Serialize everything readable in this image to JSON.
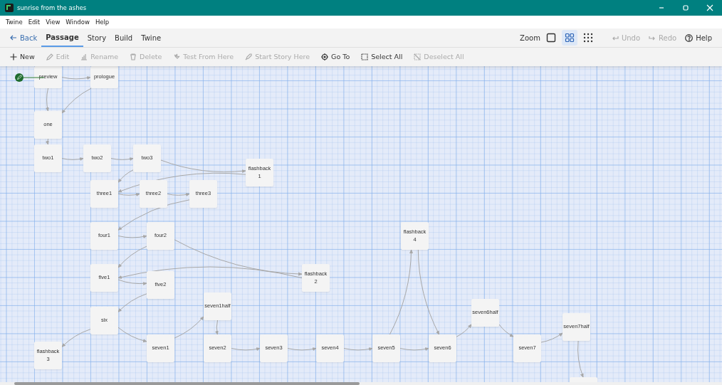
{
  "window": {
    "title": "sunrise from the ashes"
  },
  "menu": [
    "Twine",
    "Edit",
    "View",
    "Window",
    "Help"
  ],
  "back": {
    "label": "Back"
  },
  "tabs": [
    {
      "label": "Passage",
      "selected": true
    },
    {
      "label": "Story",
      "selected": false
    },
    {
      "label": "Build",
      "selected": false
    },
    {
      "label": "Twine",
      "selected": false
    }
  ],
  "zoom": {
    "label": "Zoom",
    "levels": [
      {
        "kind": "large",
        "selected": false
      },
      {
        "kind": "medium",
        "selected": true
      },
      {
        "kind": "small",
        "selected": false
      }
    ]
  },
  "history": [
    {
      "kind": "undo",
      "label": "Undo",
      "disabled": true
    },
    {
      "kind": "redo",
      "label": "Redo",
      "disabled": true
    }
  ],
  "help": {
    "label": "Help"
  },
  "actions": [
    {
      "kind": "new",
      "label": "New",
      "disabled": false
    },
    {
      "kind": "edit",
      "label": "Edit",
      "disabled": true
    },
    {
      "kind": "rename",
      "label": "Rename",
      "disabled": true
    },
    {
      "kind": "delete",
      "label": "Delete",
      "disabled": true
    },
    {
      "kind": "test",
      "label": "Test From Here",
      "disabled": true
    },
    {
      "kind": "start",
      "label": "Start Story Here",
      "disabled": true
    },
    {
      "kind": "goto",
      "label": "Go To",
      "disabled": false
    },
    {
      "kind": "select",
      "label": "Select All",
      "disabled": false
    },
    {
      "kind": "deselect",
      "label": "Deselect All",
      "disabled": true
    }
  ],
  "passages": [
    {
      "kind": "passage",
      "name": "preview",
      "start": true
    },
    {
      "kind": "passage",
      "name": "prologue",
      "start": false
    },
    {
      "kind": "passage",
      "name": "one",
      "start": false
    },
    {
      "kind": "passage",
      "name": "two1",
      "start": false
    },
    {
      "kind": "passage",
      "name": "two2",
      "start": false
    },
    {
      "kind": "passage",
      "name": "two3",
      "start": false
    },
    {
      "kind": "passage",
      "name": "flashback 1",
      "start": false
    },
    {
      "kind": "passage",
      "name": "three1",
      "start": false
    },
    {
      "kind": "passage",
      "name": "three2",
      "start": false
    },
    {
      "kind": "passage",
      "name": "three3",
      "start": false
    },
    {
      "kind": "passage",
      "name": "four1",
      "start": false
    },
    {
      "kind": "passage",
      "name": "four2",
      "start": false
    },
    {
      "kind": "passage",
      "name": "five1",
      "start": false
    },
    {
      "kind": "passage",
      "name": "five2",
      "start": false
    },
    {
      "kind": "passage",
      "name": "flashback 2",
      "start": false
    },
    {
      "kind": "passage",
      "name": "six",
      "start": false
    },
    {
      "kind": "passage",
      "name": "seven1half",
      "start": false
    },
    {
      "kind": "passage",
      "name": "flashback 3",
      "start": false
    },
    {
      "kind": "passage",
      "name": "seven1",
      "start": false
    },
    {
      "kind": "passage",
      "name": "seven2",
      "start": false
    },
    {
      "kind": "passage",
      "name": "seven3",
      "start": false
    },
    {
      "kind": "passage",
      "name": "seven4",
      "start": false
    },
    {
      "kind": "passage",
      "name": "seven5",
      "start": false
    },
    {
      "kind": "passage",
      "name": "seven6",
      "start": false
    },
    {
      "kind": "passage",
      "name": "seven6half",
      "start": false
    },
    {
      "kind": "passage",
      "name": "seven7",
      "start": false
    },
    {
      "kind": "passage",
      "name": "seven7half",
      "start": false
    },
    {
      "kind": "passage",
      "name": "flashback 4",
      "start": false
    },
    {
      "kind": "cut-off",
      "start": false
    }
  ]
}
